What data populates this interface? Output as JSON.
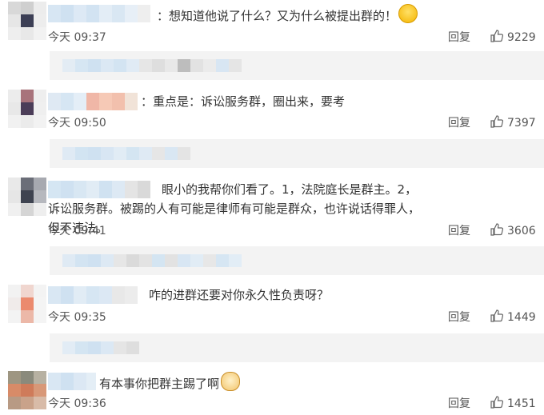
{
  "comments": [
    {
      "text": "：想知道他说了什么？又为什么被提出群的！",
      "emoji": "laughing-emoji",
      "time": "今天 09:37",
      "reply": "回复",
      "likes": "9229"
    },
    {
      "text": "：重点是：诉讼服务群，圈出来，要考",
      "time": "今天 09:50",
      "reply": "回复",
      "likes": "7397"
    },
    {
      "text": "眼小的我帮你们看了。1，法院庭长是群主。2，诉讼服务群。被踢的人有可能是律师有可能是群众，也许说话得罪人，但不违法。",
      "time": "今天 09:41",
      "reply": "回复",
      "likes": "3606"
    },
    {
      "text": "咋的进群还要对你永久性负责呀？",
      "time": "今天 09:35",
      "reply": "回复",
      "likes": "1449"
    },
    {
      "text": "有本事你把群主踢了啊",
      "emoji": "cat-emoji",
      "time": "今天 09:36",
      "reply": "回复",
      "likes": "1451"
    }
  ],
  "colors": {
    "blur_blue": "#cfe1f1",
    "blur_grey": "#bdbdbd",
    "reply_bg": "#f3f3f3",
    "text": "#333333",
    "meta": "#555555"
  }
}
